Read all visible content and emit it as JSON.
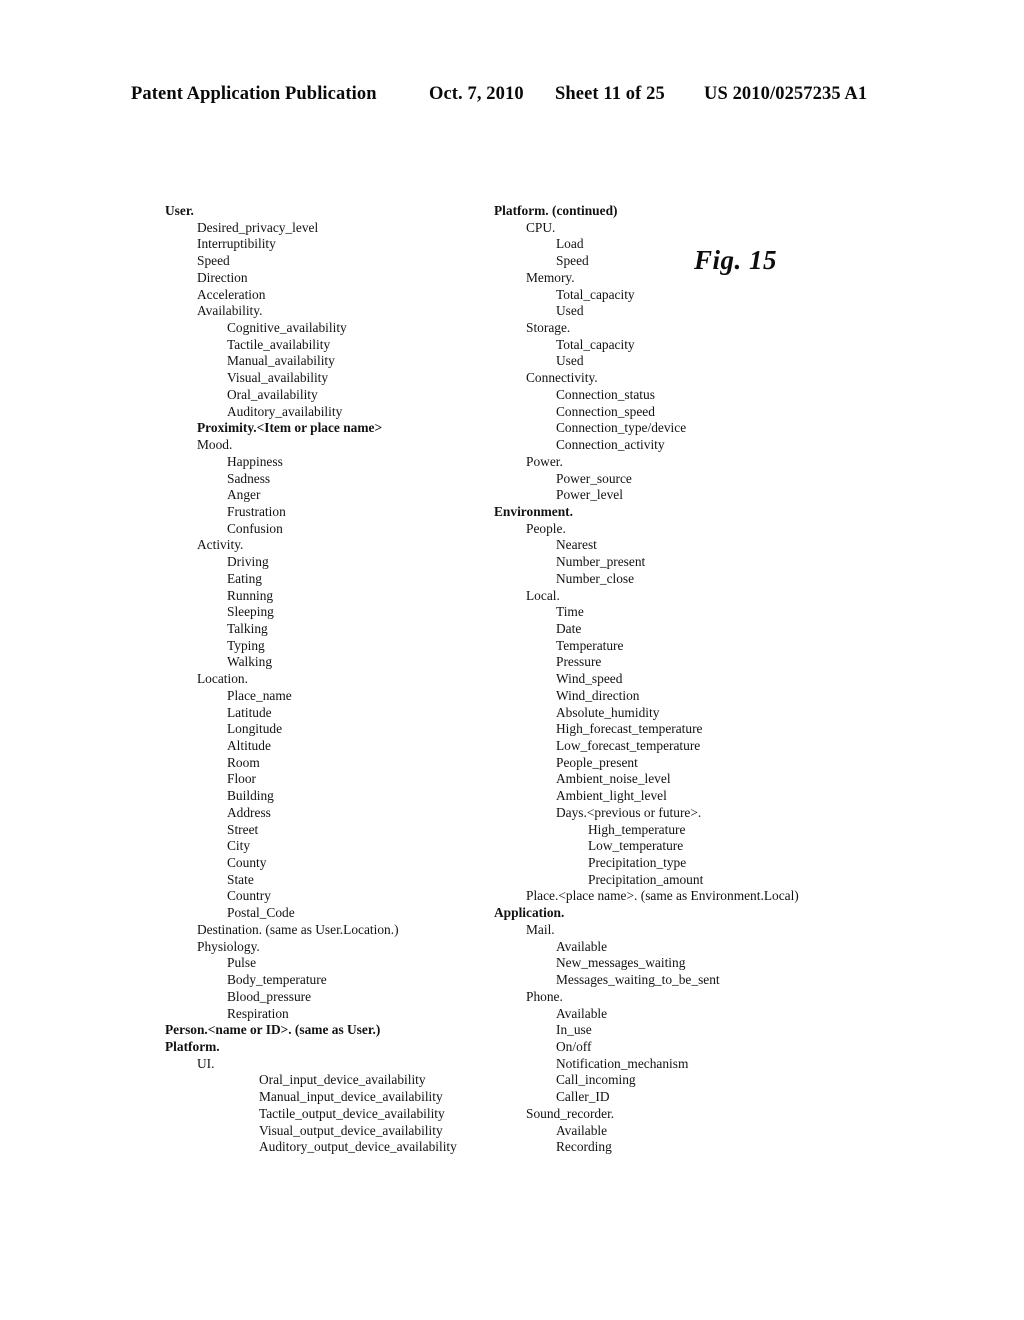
{
  "header": {
    "publication": "Patent Application Publication",
    "date": "Oct. 7, 2010",
    "sheet": "Sheet 11 of 25",
    "patent_number": "US 2010/0257235 A1"
  },
  "figure": {
    "label": "Fig. 15"
  },
  "left_column": [
    {
      "text": "User.",
      "level": 0,
      "bold": true
    },
    {
      "text": "Desired_privacy_level",
      "level": 1,
      "bold": false
    },
    {
      "text": "Interruptibility",
      "level": 1,
      "bold": false
    },
    {
      "text": "Speed",
      "level": 1,
      "bold": false
    },
    {
      "text": "Direction",
      "level": 1,
      "bold": false
    },
    {
      "text": "Acceleration",
      "level": 1,
      "bold": false
    },
    {
      "text": "Availability.",
      "level": 1,
      "bold": false
    },
    {
      "text": "Cognitive_availability",
      "level": 2,
      "bold": false
    },
    {
      "text": "Tactile_availability",
      "level": 2,
      "bold": false
    },
    {
      "text": "Manual_availability",
      "level": 2,
      "bold": false
    },
    {
      "text": "Visual_availability",
      "level": 2,
      "bold": false
    },
    {
      "text": "Oral_availability",
      "level": 2,
      "bold": false
    },
    {
      "text": "Auditory_availability",
      "level": 2,
      "bold": false
    },
    {
      "text": "Proximity.<Item or place name>",
      "level": 1,
      "bold": true
    },
    {
      "text": "Mood.",
      "level": 1,
      "bold": false
    },
    {
      "text": "Happiness",
      "level": 2,
      "bold": false
    },
    {
      "text": "Sadness",
      "level": 2,
      "bold": false
    },
    {
      "text": "Anger",
      "level": 2,
      "bold": false
    },
    {
      "text": "Frustration",
      "level": 2,
      "bold": false
    },
    {
      "text": "Confusion",
      "level": 2,
      "bold": false
    },
    {
      "text": "Activity.",
      "level": 1,
      "bold": false
    },
    {
      "text": "Driving",
      "level": 2,
      "bold": false
    },
    {
      "text": "Eating",
      "level": 2,
      "bold": false
    },
    {
      "text": "Running",
      "level": 2,
      "bold": false
    },
    {
      "text": "Sleeping",
      "level": 2,
      "bold": false
    },
    {
      "text": "Talking",
      "level": 2,
      "bold": false
    },
    {
      "text": "Typing",
      "level": 2,
      "bold": false
    },
    {
      "text": "Walking",
      "level": 2,
      "bold": false
    },
    {
      "text": "Location.",
      "level": 1,
      "bold": false
    },
    {
      "text": "Place_name",
      "level": 2,
      "bold": false
    },
    {
      "text": "Latitude",
      "level": 2,
      "bold": false
    },
    {
      "text": "Longitude",
      "level": 2,
      "bold": false
    },
    {
      "text": "Altitude",
      "level": 2,
      "bold": false
    },
    {
      "text": "Room",
      "level": 2,
      "bold": false
    },
    {
      "text": "Floor",
      "level": 2,
      "bold": false
    },
    {
      "text": "Building",
      "level": 2,
      "bold": false
    },
    {
      "text": "Address",
      "level": 2,
      "bold": false
    },
    {
      "text": "Street",
      "level": 2,
      "bold": false
    },
    {
      "text": "City",
      "level": 2,
      "bold": false
    },
    {
      "text": "County",
      "level": 2,
      "bold": false
    },
    {
      "text": "State",
      "level": 2,
      "bold": false
    },
    {
      "text": "Country",
      "level": 2,
      "bold": false
    },
    {
      "text": "Postal_Code",
      "level": 2,
      "bold": false
    },
    {
      "text": "Destination. (same as User.Location.)",
      "level": 1,
      "bold": false
    },
    {
      "text": "Physiology.",
      "level": 1,
      "bold": false
    },
    {
      "text": "Pulse",
      "level": 2,
      "bold": false
    },
    {
      "text": "Body_temperature",
      "level": 2,
      "bold": false
    },
    {
      "text": "Blood_pressure",
      "level": 2,
      "bold": false
    },
    {
      "text": "Respiration",
      "level": 2,
      "bold": false
    },
    {
      "text": "Person.<name or ID>. (same as User.)",
      "level": 0,
      "bold": true
    },
    {
      "text": "Platform.",
      "level": 0,
      "bold": true
    },
    {
      "text": "UI.",
      "level": 1,
      "bold": false
    },
    {
      "text": "Oral_input_device_availability",
      "level": 3,
      "bold": false
    },
    {
      "text": "Manual_input_device_availability",
      "level": 3,
      "bold": false
    },
    {
      "text": "Tactile_output_device_availability",
      "level": 3,
      "bold": false
    },
    {
      "text": "Visual_output_device_availability",
      "level": 3,
      "bold": false
    },
    {
      "text": "Auditory_output_device_availability",
      "level": 3,
      "bold": false
    }
  ],
  "right_column": [
    {
      "text": "Platform. (continued)",
      "level": 0,
      "bold": true
    },
    {
      "text": "CPU.",
      "level": 1,
      "bold": false
    },
    {
      "text": "Load",
      "level": 2,
      "bold": false
    },
    {
      "text": "Speed",
      "level": 2,
      "bold": false
    },
    {
      "text": "Memory.",
      "level": 1,
      "bold": false
    },
    {
      "text": "Total_capacity",
      "level": 2,
      "bold": false
    },
    {
      "text": "Used",
      "level": 2,
      "bold": false
    },
    {
      "text": "Storage.",
      "level": 1,
      "bold": false
    },
    {
      "text": "Total_capacity",
      "level": 2,
      "bold": false
    },
    {
      "text": "Used",
      "level": 2,
      "bold": false
    },
    {
      "text": "Connectivity.",
      "level": 1,
      "bold": false
    },
    {
      "text": "Connection_status",
      "level": 2,
      "bold": false
    },
    {
      "text": "Connection_speed",
      "level": 2,
      "bold": false
    },
    {
      "text": "Connection_type/device",
      "level": 2,
      "bold": false
    },
    {
      "text": "Connection_activity",
      "level": 2,
      "bold": false
    },
    {
      "text": "Power.",
      "level": 1,
      "bold": false
    },
    {
      "text": "Power_source",
      "level": 2,
      "bold": false
    },
    {
      "text": "Power_level",
      "level": 2,
      "bold": false
    },
    {
      "text": "Environment.",
      "level": 0,
      "bold": true
    },
    {
      "text": "People.",
      "level": 1,
      "bold": false
    },
    {
      "text": "Nearest",
      "level": 2,
      "bold": false
    },
    {
      "text": "Number_present",
      "level": 2,
      "bold": false
    },
    {
      "text": "Number_close",
      "level": 2,
      "bold": false
    },
    {
      "text": "Local.",
      "level": 1,
      "bold": false
    },
    {
      "text": "Time",
      "level": 2,
      "bold": false
    },
    {
      "text": "Date",
      "level": 2,
      "bold": false
    },
    {
      "text": "Temperature",
      "level": 2,
      "bold": false
    },
    {
      "text": "Pressure",
      "level": 2,
      "bold": false
    },
    {
      "text": "Wind_speed",
      "level": 2,
      "bold": false
    },
    {
      "text": "Wind_direction",
      "level": 2,
      "bold": false
    },
    {
      "text": "Absolute_humidity",
      "level": 2,
      "bold": false
    },
    {
      "text": "High_forecast_temperature",
      "level": 2,
      "bold": false
    },
    {
      "text": "Low_forecast_temperature",
      "level": 2,
      "bold": false
    },
    {
      "text": "People_present",
      "level": 2,
      "bold": false
    },
    {
      "text": "Ambient_noise_level",
      "level": 2,
      "bold": false
    },
    {
      "text": "Ambient_light_level",
      "level": 2,
      "bold": false
    },
    {
      "text": "Days.<previous or future>.",
      "level": 2,
      "bold": false
    },
    {
      "text": "High_temperature",
      "level": 3,
      "bold": false
    },
    {
      "text": "Low_temperature",
      "level": 3,
      "bold": false
    },
    {
      "text": "Precipitation_type",
      "level": 3,
      "bold": false
    },
    {
      "text": "Precipitation_amount",
      "level": 3,
      "bold": false
    },
    {
      "text": "Place.<place name>. (same as Environment.Local)",
      "level": 1,
      "bold": false
    },
    {
      "text": "Application.",
      "level": 0,
      "bold": true
    },
    {
      "text": "Mail.",
      "level": 1,
      "bold": false
    },
    {
      "text": "Available",
      "level": 2,
      "bold": false
    },
    {
      "text": "New_messages_waiting",
      "level": 2,
      "bold": false
    },
    {
      "text": "Messages_waiting_to_be_sent",
      "level": 2,
      "bold": false
    },
    {
      "text": "Phone.",
      "level": 1,
      "bold": false
    },
    {
      "text": "Available",
      "level": 2,
      "bold": false
    },
    {
      "text": "In_use",
      "level": 2,
      "bold": false
    },
    {
      "text": "On/off",
      "level": 2,
      "bold": false
    },
    {
      "text": "Notification_mechanism",
      "level": 2,
      "bold": false
    },
    {
      "text": "Call_incoming",
      "level": 2,
      "bold": false
    },
    {
      "text": "Caller_ID",
      "level": 2,
      "bold": false
    },
    {
      "text": "Sound_recorder.",
      "level": 1,
      "bold": false
    },
    {
      "text": "Available",
      "level": 2,
      "bold": false
    },
    {
      "text": "Recording",
      "level": 2,
      "bold": false
    }
  ]
}
